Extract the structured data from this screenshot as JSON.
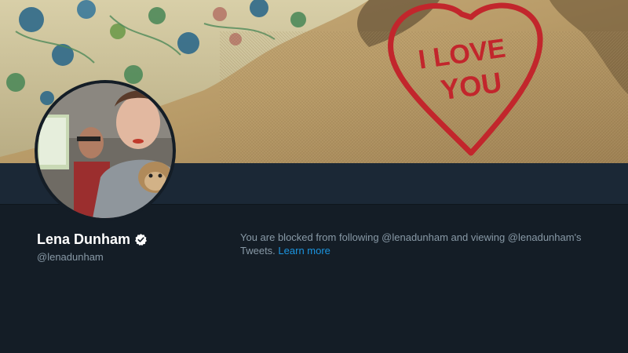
{
  "banner": {
    "message_line1": "I LOVE",
    "message_line2": "YOU"
  },
  "profile": {
    "display_name": "Lena Dunham",
    "screen_name": "@lenadunham",
    "verified": true
  },
  "blocked_notice": {
    "text": "You are blocked from following @lenadunham and viewing @lenadunham's Tweets. ",
    "link_label": "Learn more"
  },
  "colors": {
    "background": "#141d26",
    "nav": "#1b2836",
    "link": "#1b95e0",
    "muted_text": "#8899a6",
    "heart": "#c2262c"
  }
}
